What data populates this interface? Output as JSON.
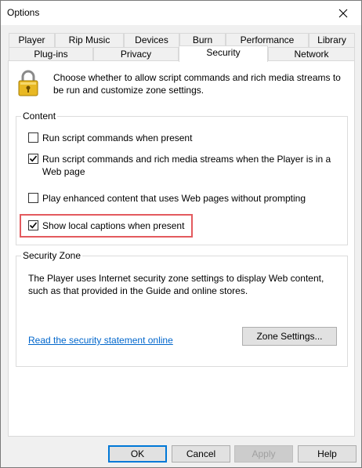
{
  "window": {
    "title": "Options"
  },
  "tabs": {
    "row1": [
      "Player",
      "Rip Music",
      "Devices",
      "Burn",
      "Performance",
      "Library"
    ],
    "row2": [
      "Plug-ins",
      "Privacy",
      "Security",
      "Network"
    ],
    "active": "Security"
  },
  "security": {
    "intro": "Choose whether to allow script commands and rich media streams to be run and customize zone settings.",
    "content_group": {
      "label": "Content",
      "options": [
        {
          "label": "Run script commands when present",
          "checked": false
        },
        {
          "label": "Run script commands and rich media streams when the Player is in a Web page",
          "checked": true
        },
        {
          "label": "Play enhanced content that uses Web pages without prompting",
          "checked": false
        },
        {
          "label": "Show local captions when present",
          "checked": true
        }
      ]
    },
    "zone_group": {
      "label": "Security Zone",
      "description": "The Player uses Internet security zone settings to display Web content, such as that provided in the Guide and online stores.",
      "link": "Read the security statement online",
      "zone_button": "Zone Settings..."
    }
  },
  "footer": {
    "ok": "OK",
    "cancel": "Cancel",
    "apply": "Apply",
    "help": "Help"
  },
  "colors": {
    "link": "#0066cc",
    "highlight_border": "#e35a5e",
    "default_button_border": "#0078d7"
  }
}
